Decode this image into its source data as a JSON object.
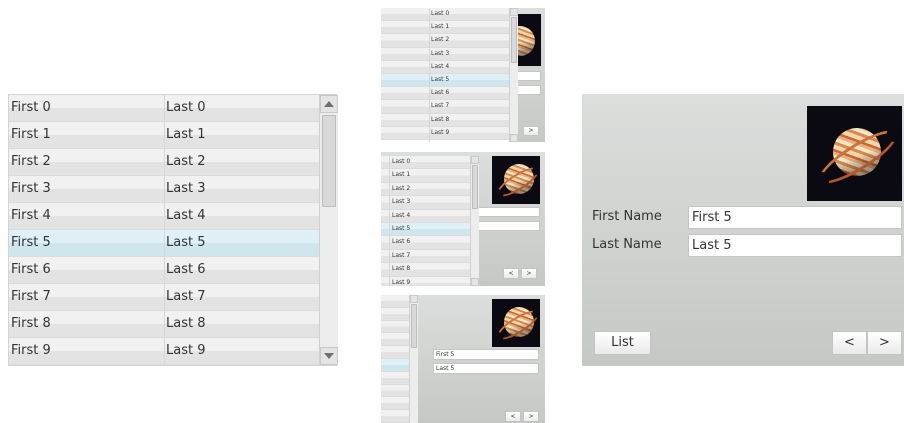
{
  "rows": [
    {
      "first": "First 0",
      "last": "Last 0"
    },
    {
      "first": "First 1",
      "last": "Last 1"
    },
    {
      "first": "First 2",
      "last": "Last 2"
    },
    {
      "first": "First 3",
      "last": "Last 3"
    },
    {
      "first": "First 4",
      "last": "Last 4"
    },
    {
      "first": "First 5",
      "last": "Last 5"
    },
    {
      "first": "First 6",
      "last": "Last 6"
    },
    {
      "first": "First 7",
      "last": "Last 7"
    },
    {
      "first": "First 8",
      "last": "Last 8"
    },
    {
      "first": "First 9",
      "last": "Last 9"
    }
  ],
  "selected_row": 5,
  "form": {
    "first_name_label": "First Name",
    "last_name_label": "Last Name",
    "first_name_value": "First 5",
    "last_name_value": "Last 5",
    "list_button": "List",
    "prev_button": "<",
    "next_button": ">"
  },
  "colors": {
    "selection": "#dff0f7",
    "panel": "#d3d5d2"
  },
  "icons": {
    "scroll_up": "triangle-up",
    "scroll_down": "triangle-down",
    "image": "saturn-image"
  }
}
